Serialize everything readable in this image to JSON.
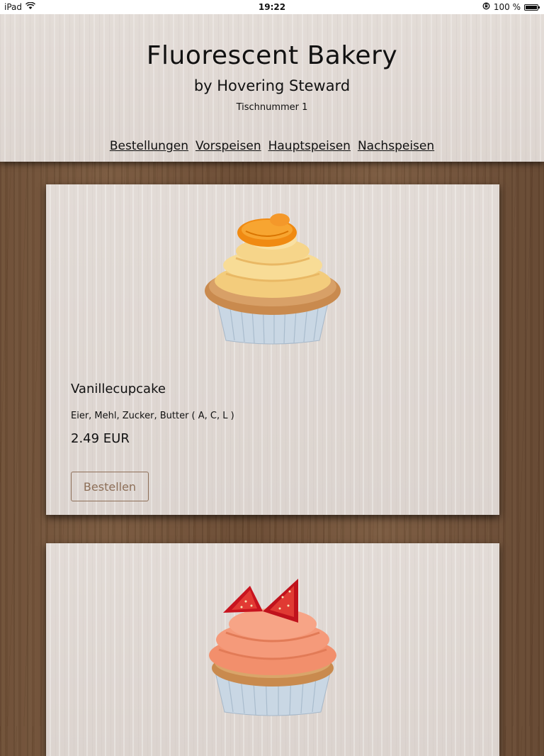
{
  "statusbar": {
    "device": "iPad",
    "time": "19:22",
    "battery": "100 %",
    "battery_level": 1.0
  },
  "header": {
    "title": "Fluorescent Bakery",
    "subtitle": "by Hovering Steward",
    "table_number": "Tischnummer 1",
    "nav": [
      {
        "label": "Bestellungen"
      },
      {
        "label": "Vorspeisen"
      },
      {
        "label": "Hauptspeisen"
      },
      {
        "label": "Nachspeisen"
      }
    ]
  },
  "items": [
    {
      "name": "Vanillecupcake",
      "ingredients": "Eier, Mehl, Zucker, Butter ( A, C, L )",
      "price": "2.49 EUR",
      "button_label": "Bestellen",
      "frosting_color": "#f6d58a",
      "topping": "mandarin"
    },
    {
      "frosting_color": "#f59a7a",
      "topping": "strawberry"
    }
  ]
}
